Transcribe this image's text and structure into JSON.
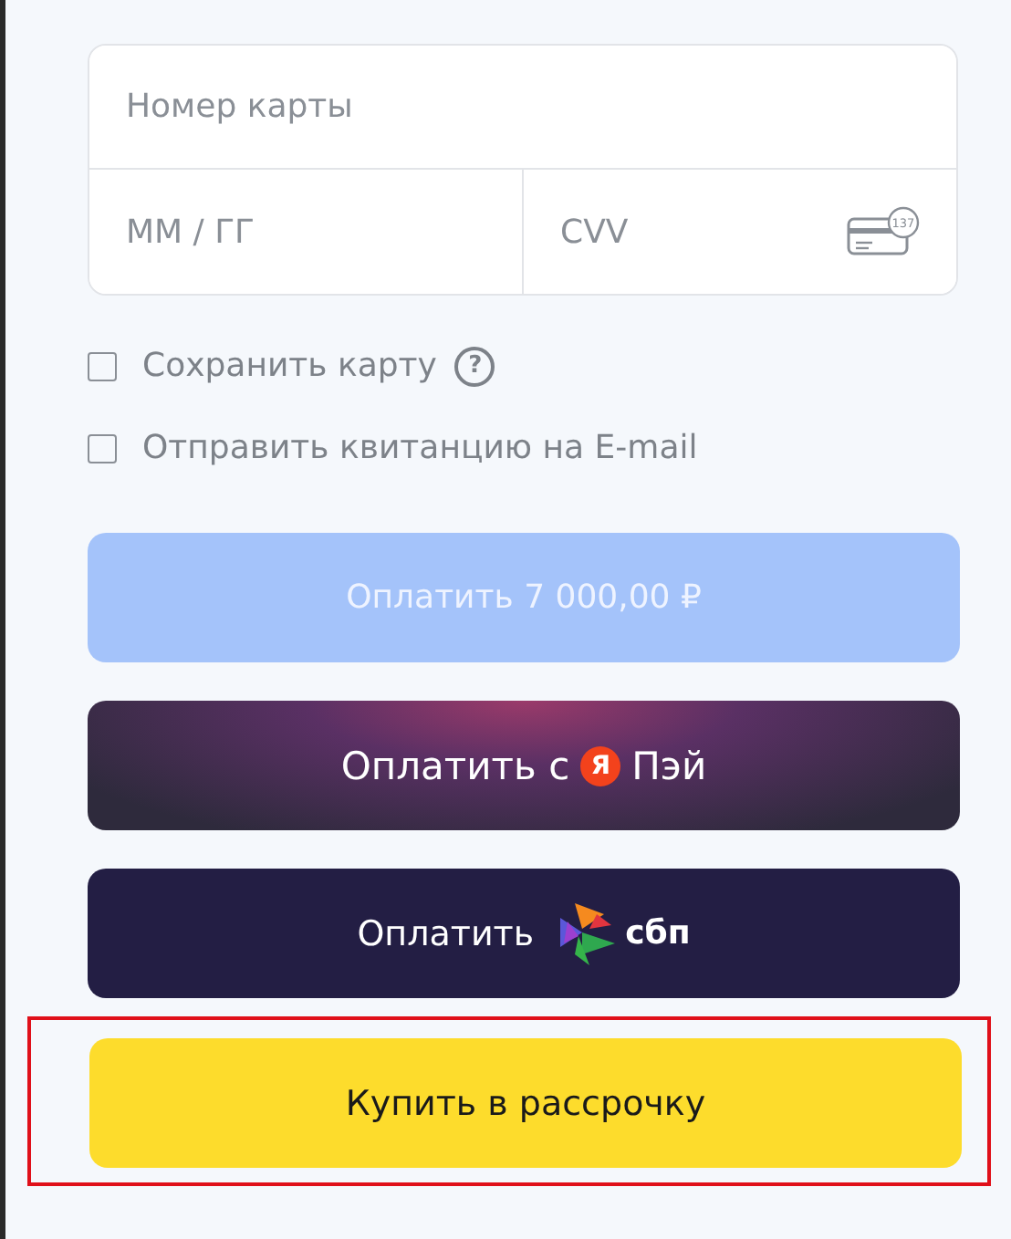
{
  "card_form": {
    "number": {
      "placeholder": "Номер карты"
    },
    "expiry": {
      "placeholder": "ММ / ГГ"
    },
    "cvv": {
      "placeholder": "CVV",
      "icon_badge": "137"
    }
  },
  "options": [
    {
      "label": "Сохранить карту",
      "checked": false,
      "help": "?"
    },
    {
      "label": "Отправить квитанцию на E-mail",
      "checked": false
    }
  ],
  "buttons": [
    {
      "kind": "pay",
      "label": "Оплатить 7 000,00 ₽",
      "disabled": true
    },
    {
      "kind": "yapay",
      "label": "Оплатить с",
      "mark": "Я",
      "suffix": "Пэй"
    },
    {
      "kind": "sbp",
      "label": "Оплатить",
      "logo_text": "сбп"
    },
    {
      "kind": "installment",
      "label": "Купить в рассрочку",
      "highlighted": true
    }
  ]
}
